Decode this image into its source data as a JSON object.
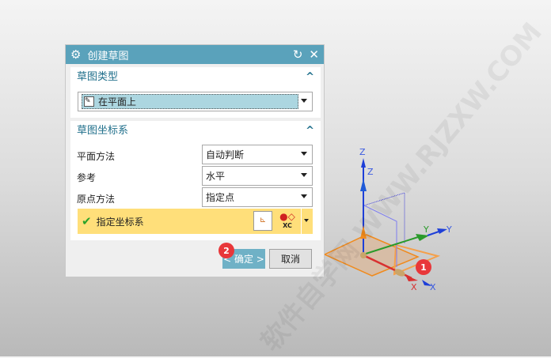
{
  "dialog": {
    "title": "创建草图",
    "reset_icon": "reset-icon",
    "close_icon": "close-icon"
  },
  "sketch_type": {
    "header": "草图类型",
    "value": "在平面上"
  },
  "sketch_csys": {
    "header": "草图坐标系",
    "rows": [
      {
        "label": "平面方法",
        "value": "自动判断"
      },
      {
        "label": "参考",
        "value": "水平"
      },
      {
        "label": "原点方法",
        "value": "指定点"
      }
    ],
    "specify_csys": "指定坐标系",
    "xc_label": "XC"
  },
  "buttons": {
    "ok": "< 确定 >",
    "cancel": "取消"
  },
  "badges": {
    "one": "1",
    "two": "2"
  },
  "axes": {
    "z1": "Z",
    "z2": "Z",
    "y1": "Y",
    "y2": "Y",
    "x1": "X",
    "x2": "X"
  },
  "watermark": "软件自学网 WWW.RJZXW.COM",
  "colors": {
    "title_bar": "#5aa2bb",
    "highlight": "#ffdf7a",
    "selected": "#acd6e0",
    "badge": "#e8373a"
  }
}
